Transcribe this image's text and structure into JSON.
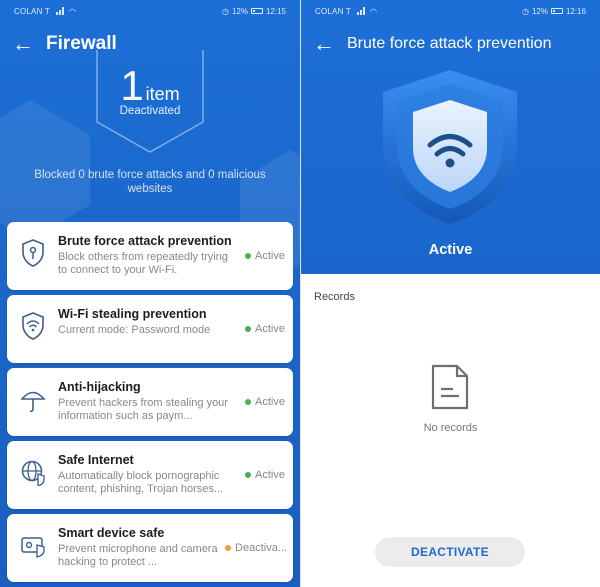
{
  "status_bar": {
    "carrier": "COLAN T",
    "battery": "12%",
    "time_left": "12:15",
    "time_right": "12:16"
  },
  "firewall_screen": {
    "title": "Firewall",
    "count": "1",
    "count_unit": "item",
    "count_status": "Deactivated",
    "blocked_text": "Blocked 0 brute force attacks and 0 malicious websites",
    "cards": [
      {
        "title": "Brute force attack prevention",
        "description": "Block others from repeatedly trying to connect to your Wi-Fi.",
        "status": "Active",
        "status_color": "#4caf50",
        "icon": "shield-key-icon"
      },
      {
        "title": "Wi-Fi stealing prevention",
        "description": "Current mode: Password mode",
        "status": "Active",
        "status_color": "#4caf50",
        "icon": "wifi-shield-icon"
      },
      {
        "title": "Anti-hijacking",
        "description": "Prevent hackers from stealing your information such as paym...",
        "status": "Active",
        "status_color": "#4caf50",
        "icon": "umbrella-icon"
      },
      {
        "title": "Safe Internet",
        "description": "Automatically block pornographic content, phishing, Trojan horses...",
        "status": "Active",
        "status_color": "#4caf50",
        "icon": "globe-shield-icon"
      },
      {
        "title": "Smart device safe",
        "description": "Prevent microphone and camera hacking to protect ...",
        "status": "Deactiva...",
        "status_color": "#f39c3a",
        "icon": "device-shield-icon"
      }
    ]
  },
  "detail_screen": {
    "title": "Brute force attack prevention",
    "status": "Active",
    "records_label": "Records",
    "empty_text": "No records",
    "deactivate_button": "DEACTIVATE"
  },
  "colors": {
    "primary_blue": "#1c6fd6",
    "active_green": "#4caf50",
    "deactivated_orange": "#f39c3a"
  }
}
